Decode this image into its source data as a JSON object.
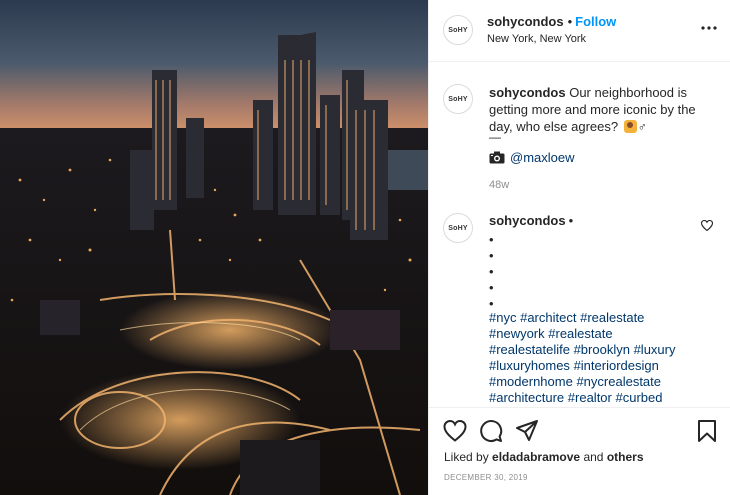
{
  "post": {
    "avatar_text": "SoHY",
    "username": "sohycondos",
    "dot": "•",
    "follow_label": "Follow",
    "location": "New York, New York",
    "more_icon": "more-options-icon"
  },
  "caption": {
    "username": "sohycondos",
    "text": "Our neighborhood is getting more and more iconic by the day, who else agrees?",
    "emoji": "woman-raising-hand-emoji",
    "male_sign": "♂",
    "dash": "—",
    "credit_handle": "@maxloew",
    "time_ago": "48w"
  },
  "comment": {
    "username": "sohycondos",
    "dot": "•",
    "bullets": [
      "•",
      "•",
      "•",
      "•",
      "•"
    ],
    "hashtag_lines": [
      [
        "#nyc",
        "#architect",
        "#realestate"
      ],
      [
        "#newyork",
        "#realestate"
      ],
      [
        "#realestatelife",
        "#brooklyn",
        "#luxury"
      ],
      [
        "#luxuryhomes",
        "#interiordesign"
      ],
      [
        "#modernhome",
        "#nycrealestate"
      ],
      [
        "#architecture",
        "#realtor",
        "#curbed"
      ]
    ]
  },
  "actions": {
    "liked_by_prefix": "Liked by",
    "liked_by_user": "eldadabramove",
    "liked_by_and": "and",
    "liked_by_others": "others",
    "date": "DECEMBER 30, 2019"
  },
  "colors": {
    "link": "#00376b",
    "follow": "#0095f6",
    "muted": "#8e8e8e",
    "text": "#262626"
  }
}
